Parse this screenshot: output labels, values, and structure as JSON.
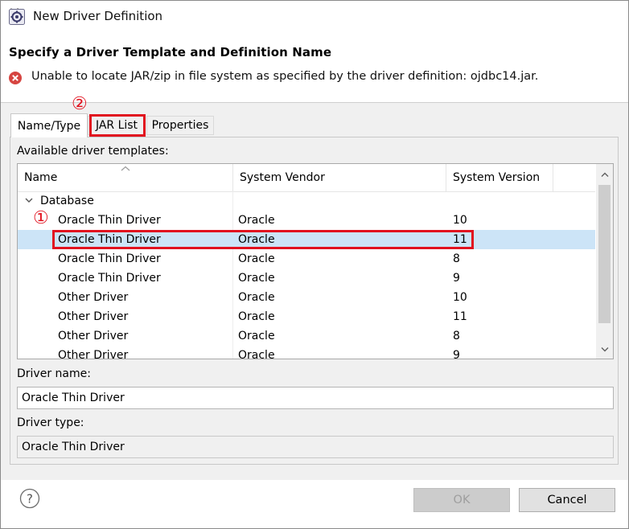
{
  "window": {
    "title": "New Driver Definition",
    "close_glyph": "✕"
  },
  "header": {
    "title": "Specify a Driver Template and Definition Name",
    "error_message": "Unable to locate JAR/zip in file system as specified by the driver definition: ojdbc14.jar."
  },
  "tabs": [
    {
      "label": "Name/Type",
      "active": true
    },
    {
      "label": "JAR List",
      "active": false
    },
    {
      "label": "Properties",
      "active": false
    }
  ],
  "annotations": {
    "marker_1": "①",
    "marker_2": "②",
    "highlight_color": "#e1121f"
  },
  "templates": {
    "label": "Available driver templates:",
    "columns": [
      "Name",
      "System Vendor",
      "System Version"
    ],
    "group": "Database",
    "rows": [
      {
        "name": "Oracle Thin Driver",
        "vendor": "Oracle",
        "version": "10",
        "selected": false
      },
      {
        "name": "Oracle Thin Driver",
        "vendor": "Oracle",
        "version": "11",
        "selected": true
      },
      {
        "name": "Oracle Thin Driver",
        "vendor": "Oracle",
        "version": "8",
        "selected": false
      },
      {
        "name": "Oracle Thin Driver",
        "vendor": "Oracle",
        "version": "9",
        "selected": false
      },
      {
        "name": "Other Driver",
        "vendor": "Oracle",
        "version": "10",
        "selected": false
      },
      {
        "name": "Other Driver",
        "vendor": "Oracle",
        "version": "11",
        "selected": false
      },
      {
        "name": "Other Driver",
        "vendor": "Oracle",
        "version": "8",
        "selected": false
      },
      {
        "name": "Other Driver",
        "vendor": "Oracle",
        "version": "9",
        "selected": false
      }
    ]
  },
  "driver_name": {
    "label": "Driver name:",
    "value": "Oracle Thin Driver"
  },
  "driver_type": {
    "label": "Driver type:",
    "value": "Oracle Thin Driver"
  },
  "footer": {
    "ok_label": "OK",
    "cancel_label": "Cancel",
    "help_glyph": "?"
  },
  "colors": {
    "selection": "#cce4f7",
    "error": "#d64541",
    "panel_bg": "#f0f0f0"
  },
  "icons": {
    "app": "gear-app-icon",
    "error": "error-icon",
    "help": "help-icon",
    "sort": "sort-up-icon",
    "group": "chevron-down-icon",
    "scroll_up": "chevron-up-icon",
    "scroll_down": "chevron-down-icon"
  }
}
